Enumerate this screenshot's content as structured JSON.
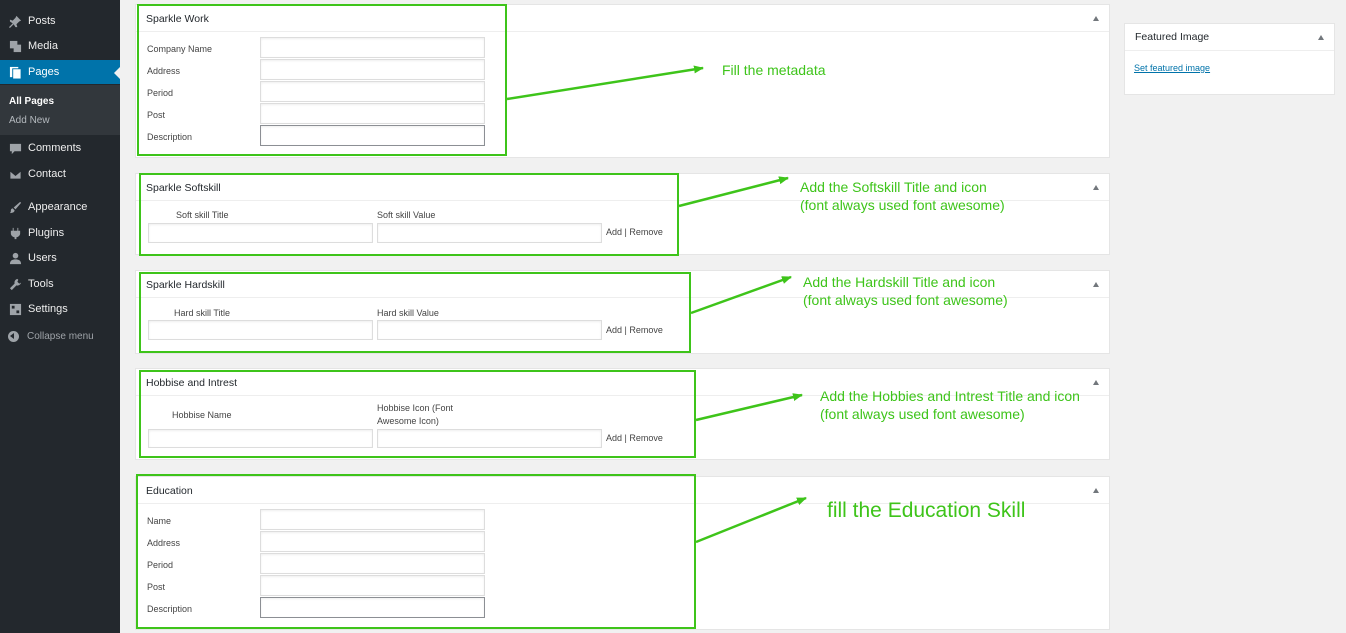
{
  "sidebar": {
    "items": [
      {
        "label": "Posts",
        "icon": "pin-icon"
      },
      {
        "label": "Media",
        "icon": "media-icon"
      },
      {
        "label": "Pages",
        "icon": "pages-icon",
        "active": true
      },
      {
        "label": "Comments",
        "icon": "comment-icon"
      },
      {
        "label": "Contact",
        "icon": "mail-icon"
      },
      {
        "label": "Appearance",
        "icon": "brush-icon"
      },
      {
        "label": "Plugins",
        "icon": "plugin-icon"
      },
      {
        "label": "Users",
        "icon": "user-icon"
      },
      {
        "label": "Tools",
        "icon": "wrench-icon"
      },
      {
        "label": "Settings",
        "icon": "settings-icon"
      }
    ],
    "submenu": [
      "All Pages",
      "Add New"
    ],
    "collapse": "Collapse menu"
  },
  "panels": {
    "work": {
      "title": "Sparkle Work",
      "fields": [
        "Company Name",
        "Address",
        "Period",
        "Post",
        "Description"
      ]
    },
    "softskill": {
      "title": "Sparkle Softskill",
      "col1": "Soft skill Title",
      "col2": "Soft skill Value",
      "add": "Add",
      "sep": "|",
      "remove": "Remove"
    },
    "hardskill": {
      "title": "Sparkle Hardskill",
      "col1": "Hard skill Title",
      "col2": "Hard skill Value",
      "add": "Add",
      "sep": "|",
      "remove": "Remove"
    },
    "hobbies": {
      "title": "Hobbise and Intrest",
      "col1": "Hobbise Name",
      "col2_line1": "Hobbise Icon (Font",
      "col2_line2": "Awesome Icon)",
      "add": "Add",
      "sep": "|",
      "remove": "Remove"
    },
    "education": {
      "title": "Education",
      "fields": [
        "Name",
        "Address",
        "Period",
        "Post",
        "Description"
      ]
    }
  },
  "featured_image": {
    "title": "Featured Image",
    "link": "Set featured image"
  },
  "annotations": {
    "metadata": "Fill the metadata",
    "softskill_line1": "Add the Softskill Title and icon",
    "softskill_line2": "(font always used font awesome)",
    "hardskill_line1": "Add the Hardskill Title and icon",
    "hardskill_line2": "(font always used font awesome)",
    "hobbies_line1": "Add the Hobbies and Intrest Title and icon",
    "hobbies_line2": "(font always used font awesome)",
    "education": "fill the Education Skill"
  },
  "colors": {
    "annotation_green": "#3ec41a",
    "sidebar_bg": "#23282d",
    "active_blue": "#0073aa"
  }
}
